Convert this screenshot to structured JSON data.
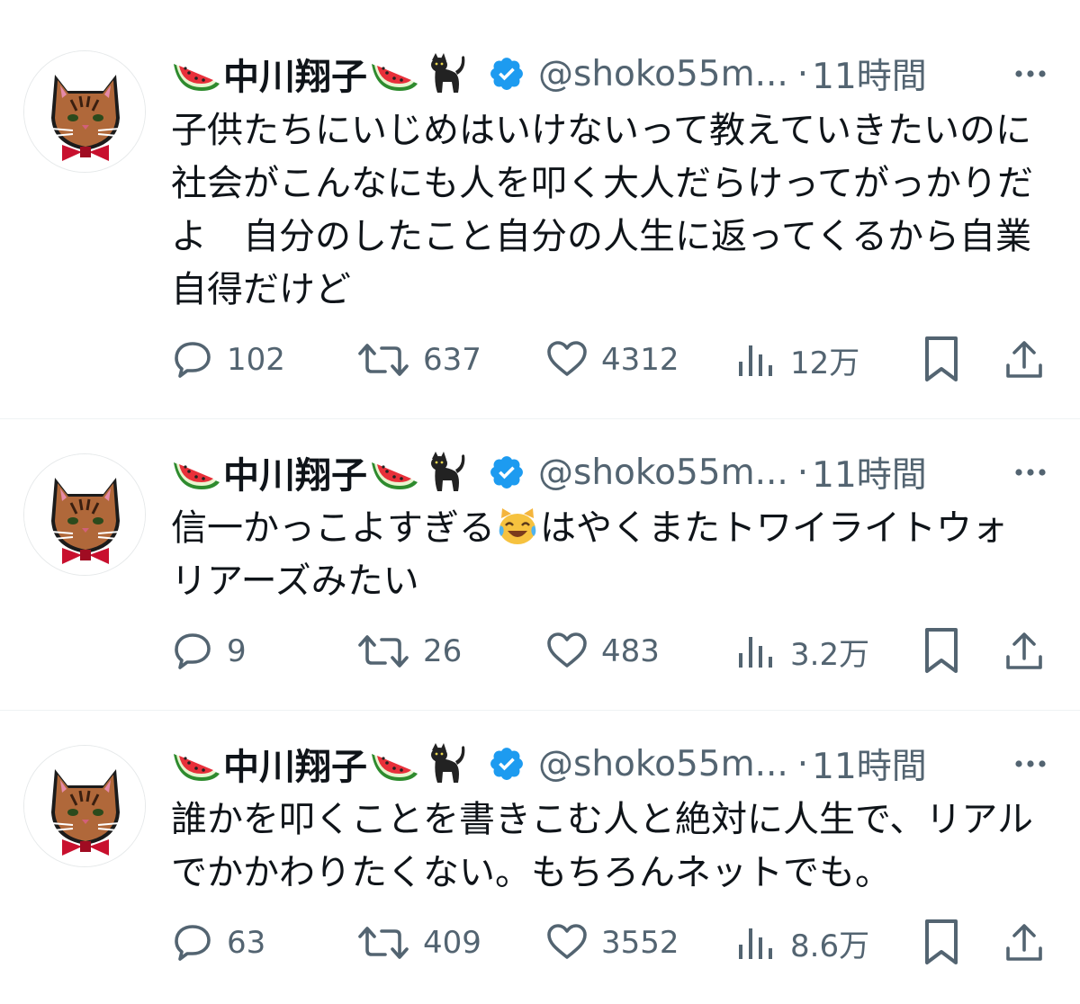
{
  "author": {
    "display_name": "中川翔子",
    "handle": "@shoko55m...",
    "separator": "·",
    "verified": true,
    "avatar_icon": "cat-avatar-icon",
    "name_emojis": [
      "watermelon-emoji",
      "watermelon-emoji",
      "black-cat-emoji"
    ]
  },
  "colors": {
    "text": "#0f1419",
    "secondary": "#536471",
    "verified_blue": "#1d9bf0",
    "divider": "#eff3f4"
  },
  "tweets": [
    {
      "time": "11時間",
      "text": "子供たちにいじめはいけないって教えていきたいのに社会がこんなにも人を叩く大人だらけってがっかりだよ　自分のしたこと自分の人生に返ってくるから自業自得だけど",
      "replies": "102",
      "retweets": "637",
      "likes": "4312",
      "views": "12万"
    },
    {
      "time": "11時間",
      "text_before": "信一かっこよすぎる",
      "text_emoji": "joy-cat-emoji",
      "text_after": "はやくまたトワイライトウォリアーズみたい",
      "replies": "9",
      "retweets": "26",
      "likes": "483",
      "views": "3.2万"
    },
    {
      "time": "11時間",
      "text": "誰かを叩くことを書きこむ人と絶対に人生で、リアルでかかわりたくない。もちろんネットでも。",
      "replies": "63",
      "retweets": "409",
      "likes": "3552",
      "views": "8.6万"
    }
  ]
}
